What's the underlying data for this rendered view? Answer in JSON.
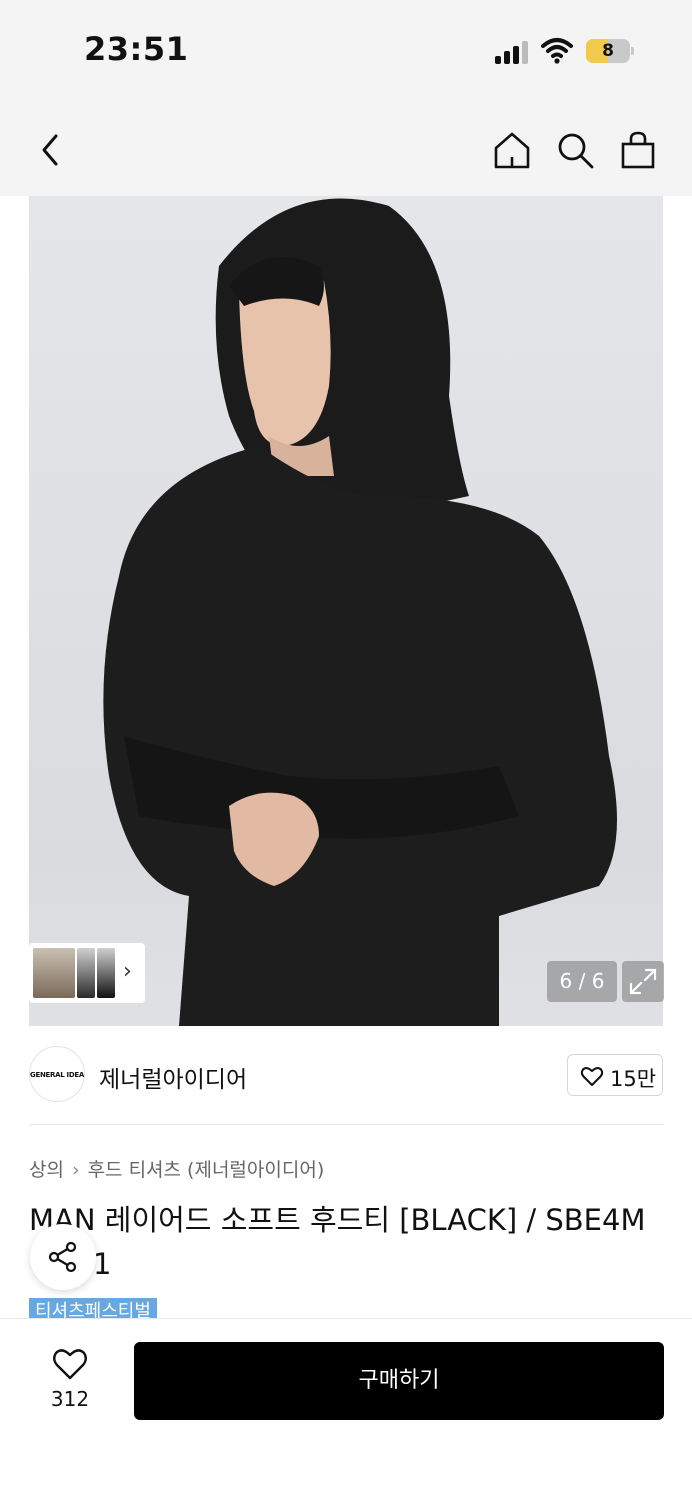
{
  "status_bar": {
    "time": "23:51",
    "battery": "8"
  },
  "nav": {
    "icons": [
      "back-icon",
      "home-icon",
      "search-icon",
      "bag-icon"
    ]
  },
  "gallery": {
    "counter": "6 / 6",
    "current_index": 6,
    "total": 6,
    "thumb_arrow": "›"
  },
  "brand": {
    "logo_text": "GENERAL IDEA",
    "name": "제너럴아이디어",
    "likes": "15만"
  },
  "breadcrumb": {
    "category": "상의",
    "sub": "후드 티셔츠 (제너럴아이디어)"
  },
  "product": {
    "title": "MAN 레이어드 소프트 후드티 [BLACK] / SBE4M",
    "title_line2": "1"
  },
  "tag": "티셔츠페스티벌",
  "bottom": {
    "wish_count": "312",
    "buy_label": "구매하기"
  },
  "colors": {
    "accent_tag": "#66a8df",
    "buy_button": "#000000"
  }
}
